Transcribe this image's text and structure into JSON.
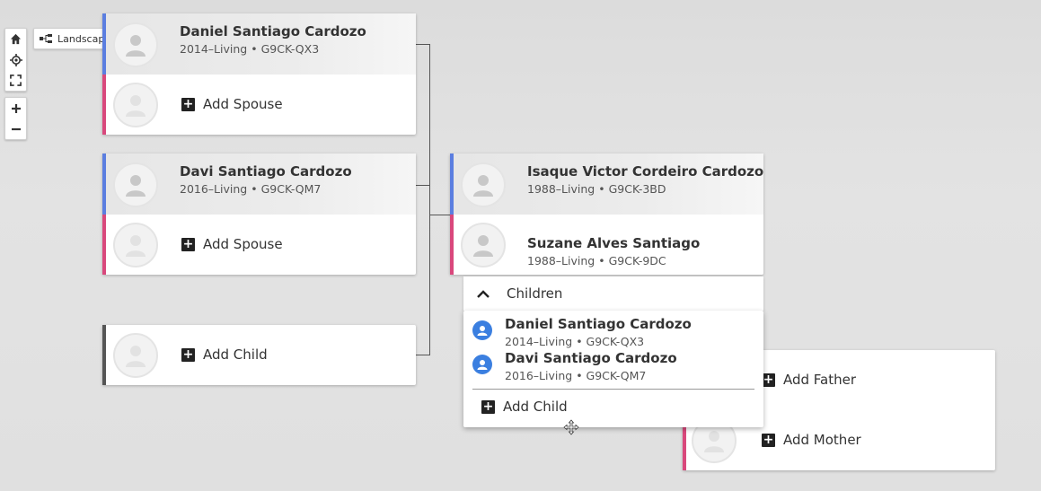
{
  "controls": {
    "view_mode": "Landscape",
    "icons": [
      "home-icon",
      "recenter-icon",
      "fullscreen-icon",
      "zoom-in-icon",
      "zoom-out-icon",
      "tree-layout-icon",
      "dropdown-caret-icon"
    ]
  },
  "cards": {
    "daniel": {
      "name": "Daniel Santiago Cardozo",
      "meta_years": "2014–Living",
      "meta_sep": "•",
      "meta_id": "G9CK-QX3",
      "add_spouse": "Add Spouse"
    },
    "davi": {
      "name": "Davi Santiago Cardozo",
      "meta_years": "2016–Living",
      "meta_sep": "•",
      "meta_id": "G9CK-QM7",
      "add_spouse": "Add Spouse"
    },
    "add_child_card": {
      "label": "Add Child"
    },
    "isaque": {
      "name": "Isaque Victor Cordeiro Cardozo",
      "meta_years": "1988–Living",
      "meta_sep": "•",
      "meta_id": "G9CK-3BD"
    },
    "suzane": {
      "name": "Suzane Alves Santiago",
      "meta_years": "1988–Living",
      "meta_sep": "•",
      "meta_id": "G9CK-9DC"
    },
    "parents_card": {
      "add_father": "Add Father",
      "add_mother": "Add Mother"
    }
  },
  "children_popup": {
    "header": "Children",
    "items": [
      {
        "name": "Daniel Santiago Cardozo",
        "meta": "2014–Living • G9CK-QX3"
      },
      {
        "name": "Davi Santiago Cardozo",
        "meta": "2016–Living • G9CK-QM7"
      }
    ],
    "add_child": "Add Child"
  },
  "colors": {
    "male": "#5b7ee0",
    "female": "#d9487c",
    "child_icon": "#3b7fe0"
  }
}
